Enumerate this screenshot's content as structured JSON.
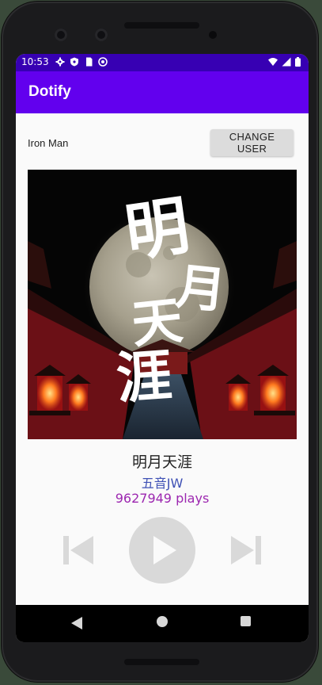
{
  "status_bar": {
    "time": "10:53",
    "left_icons": [
      "settings-icon",
      "shield-icon",
      "sim-card-icon",
      "circle-sync-icon"
    ],
    "right_icons": [
      "wifi-icon",
      "signal-icon",
      "battery-icon"
    ]
  },
  "app_bar": {
    "title": "Dotify"
  },
  "user": {
    "name": "Iron Man",
    "change_button_label": "CHANGE USER"
  },
  "album_art": {
    "artwork_text": "明月天涯"
  },
  "song": {
    "title": "明月天涯",
    "artist": "五音JW",
    "plays": "9627949 plays"
  },
  "controls": {
    "prev_icon": "skip-previous-icon",
    "play_icon": "play-icon",
    "next_icon": "skip-next-icon"
  },
  "nav_bar": {
    "back_icon": "back-triangle-icon",
    "home_icon": "home-circle-icon",
    "recents_icon": "recents-square-icon"
  },
  "colors": {
    "status_bar": "#3700b3",
    "app_bar": "#6200ee",
    "artist_text": "#3f51b5",
    "plays_text": "#9c27b0",
    "control_disabled": "#d9d9d9"
  }
}
